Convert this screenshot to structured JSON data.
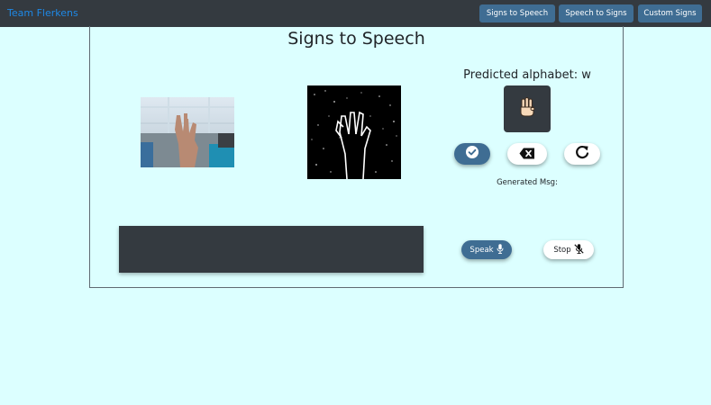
{
  "navbar": {
    "brand": "Team Flerkens",
    "buttons": [
      {
        "label": "Signs to Speech"
      },
      {
        "label": "Speech to Signs"
      },
      {
        "label": "Custom Signs"
      }
    ]
  },
  "main": {
    "title": "Signs to Speech",
    "prediction_label": "Predicted alphabet: w",
    "generated_msg_label": "Generated Msg:",
    "generated_msg_value": "",
    "speak_label": "Speak",
    "stop_label": "Stop"
  },
  "colors": {
    "page_bg": "#dcffff",
    "navbar_bg": "#343a40",
    "accent": "#3f6d93",
    "brand": "#1e88e5"
  },
  "icons": {
    "prediction": "hand-w-icon",
    "confirm": "check-circle-icon",
    "backspace": "backspace-icon",
    "reset": "redo-icon",
    "speak": "microphone-icon",
    "stop": "microphone-slash-icon"
  }
}
